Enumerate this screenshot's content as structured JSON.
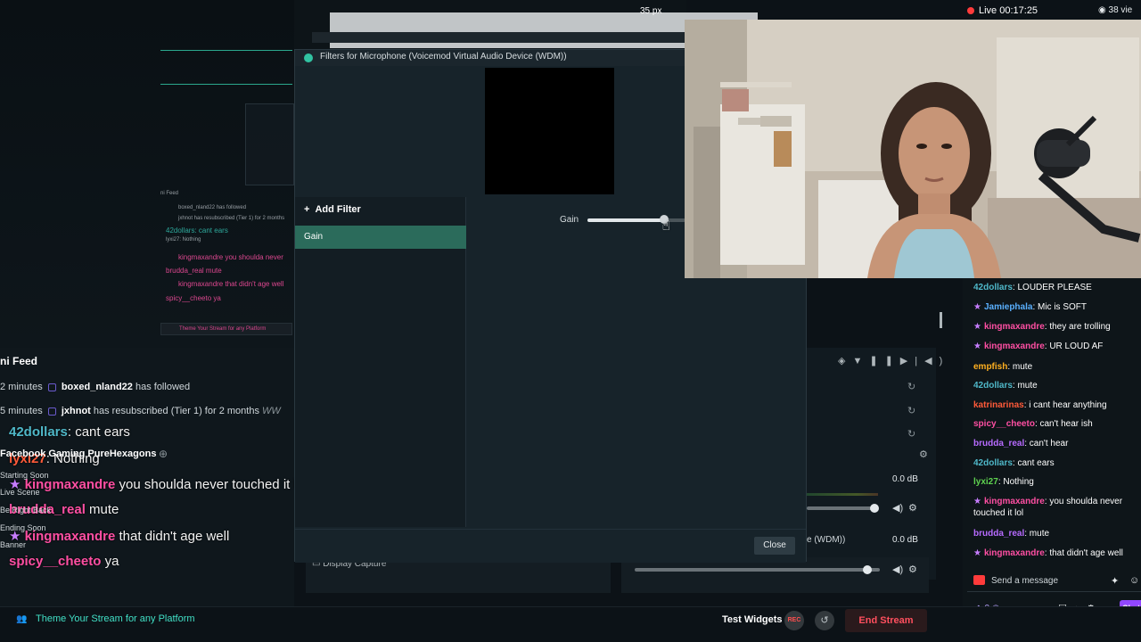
{
  "top": {
    "zoom_readout": "35 px",
    "live_label": "Live 00:17:25",
    "viewers": "38 vie"
  },
  "dialog": {
    "title": "Filters for Microphone (Voicemod Virtual Audio Device (WDM))",
    "add_filter_label": "Add Filter",
    "filters": [
      "Gain"
    ],
    "gain_label": "Gain",
    "gain_value": 0.78,
    "close_label": "Close"
  },
  "activity_feed": {
    "header": "ni Feed",
    "rows": [
      {
        "time": "2 minutes",
        "user": "boxed_nland22",
        "action": "has followed",
        "note": ""
      },
      {
        "time": "5 minutes",
        "user": "jxhnot",
        "action": "has resubscribed (Tier 1) for 2 months",
        "note": "WW"
      }
    ]
  },
  "scene": {
    "title": "Facebook Gaming PureHexagons",
    "labels": [
      "Starting Soon",
      "Live Scene",
      "Be Right Back",
      "Ending Soon",
      "Banner"
    ]
  },
  "overlay_chat": [
    {
      "user": "42dollars",
      "text": ": cant ears",
      "color": "teal"
    },
    {
      "user": "lyxi27",
      "text": ": Nothing",
      "color": "orange"
    },
    {
      "user": "kingmaxandre",
      "text": "you shoulda never touched it lol",
      "color": "pink"
    },
    {
      "user": "brudda_real",
      "text": "mute",
      "color": "pink"
    },
    {
      "user": "kingmaxandre",
      "text": "that didn't age well",
      "color": "pink"
    },
    {
      "user": "spicy__cheeto",
      "text": "ya",
      "color": "pink"
    }
  ],
  "mini_preview": {
    "feed_label": "ni Feed",
    "rows": [
      "boxed_nland22 has followed",
      "jxhnot has resubscribed (Tier 1) for 2 months",
      "42dollars: cant ears",
      "lyxi27: Nothing",
      "kingmaxandre you shoulda never",
      "brudda_real mute",
      "kingmaxandre that didn't age well",
      "spicy__cheeto ya"
    ],
    "banner": "Theme Your Stream for any Platform"
  },
  "mixer": {
    "tracks": [
      {
        "label": "",
        "db": "0.0 dB",
        "level": 0.95
      },
      {
        "label": "e (WDM))",
        "db": "0.0 dB",
        "level": 0.95
      }
    ],
    "display_capture": "Display Capture"
  },
  "chat": {
    "messages": [
      {
        "user": "42dollars",
        "text": ": LOUDER PLEASE",
        "color": "#4fb8c9",
        "badge": false
      },
      {
        "user": "Jamiephala",
        "text": ": Mic is SOFT",
        "color": "#5ab0ff",
        "badge": true
      },
      {
        "user": "kingmaxandre",
        "text": ": they are trolling",
        "color": "#ff4fa3",
        "badge": true
      },
      {
        "user": "kingmaxandre",
        "text": ": UR LOUD AF",
        "color": "#ff4fa3",
        "badge": true
      },
      {
        "user": "empfish",
        "text": ": mute",
        "color": "#ffb020",
        "badge": false
      },
      {
        "user": "42dollars",
        "text": ": mute",
        "color": "#4fb8c9",
        "badge": false
      },
      {
        "user": "katrinarinas",
        "text": ": i cant hear anything",
        "color": "#ff5a39",
        "badge": false
      },
      {
        "user": "spicy__cheeto",
        "text": ": can't hear ish",
        "color": "#ff4fa3",
        "badge": false
      },
      {
        "user": "brudda_real",
        "text": ": can't hear",
        "color": "#b76bff",
        "badge": false
      },
      {
        "user": "42dollars",
        "text": ": cant ears",
        "color": "#4fb8c9",
        "badge": false
      },
      {
        "user": "lyxi27",
        "text": ": Nothing",
        "color": "#5ed14f",
        "badge": false
      },
      {
        "user": "kingmaxandre",
        "text": ": you shoulda never touched it lol",
        "color": "#ff4fa3",
        "badge": true
      },
      {
        "user": "brudda_real",
        "text": ": mute",
        "color": "#b76bff",
        "badge": false
      },
      {
        "user": "kingmaxandre",
        "text": ": that didn't age well",
        "color": "#ff4fa3",
        "badge": true
      }
    ],
    "input_placeholder": "Send a message",
    "points": "0",
    "chat_tab": "Chat"
  },
  "bottom": {
    "theme_link": "Theme Your Stream for any Platform",
    "test_widgets": "Test Widgets",
    "rec_label": "REC",
    "end_stream": "End Stream"
  }
}
